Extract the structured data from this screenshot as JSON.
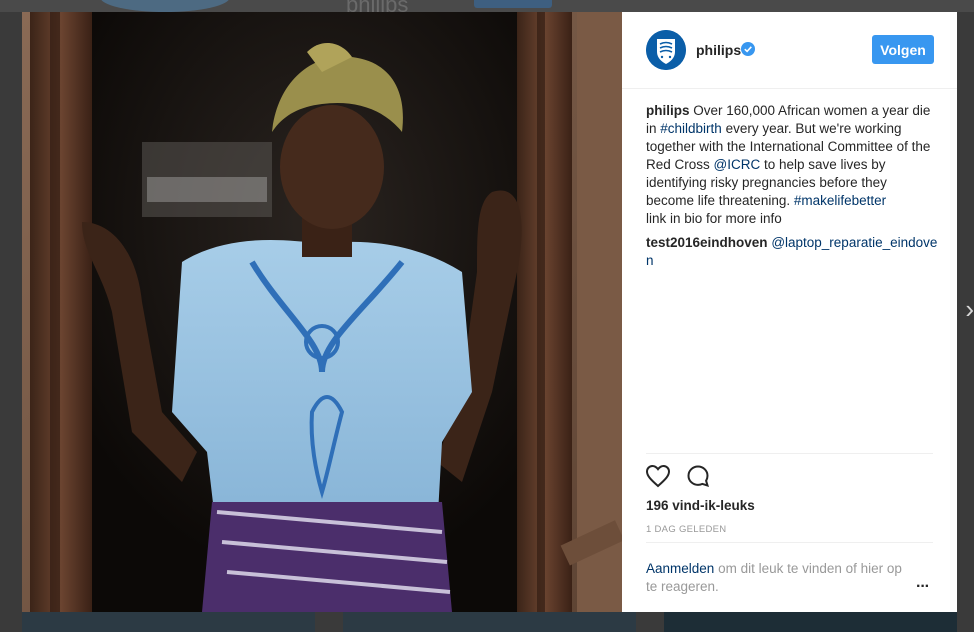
{
  "post": {
    "username": "philips",
    "follow_label": "Volgen",
    "caption_username": "philips",
    "caption_parts": {
      "t1": " Over 160,000 African women a year die in ",
      "tag1": "#childbirth",
      "t2": " every year. But we're working together with the International Committee of the Red Cross ",
      "mention1": "@ICRC",
      "t3": " to help save lives by identifying risky pregnancies before they become life threatening. ",
      "tag2": "#makelifebetter"
    },
    "caption_extra": "link in bio for more info",
    "comment": {
      "username": "test2016eindhoven",
      "mention": "@laptop_reparatie_eindoven"
    },
    "likes": "196 vind-ik-leuks",
    "timestamp": "1 DAG GELEDEN",
    "footer": {
      "login_link": "Aanmelden",
      "text": " om dit leuk te vinden of hier op te reageren."
    },
    "more_icon": "···"
  },
  "backdrop": {
    "ghost_name": "philips",
    "next_arrow": "›"
  },
  "icons": {
    "avatar": "philips-shield-logo",
    "verified": "verified-badge-icon",
    "like": "heart-icon",
    "comment": "comment-bubble-icon",
    "more": "more-options-icon",
    "next": "chevron-right-icon"
  },
  "colors": {
    "follow_button": "#3897f0",
    "link": "#003569",
    "verified": "#3897f0"
  }
}
